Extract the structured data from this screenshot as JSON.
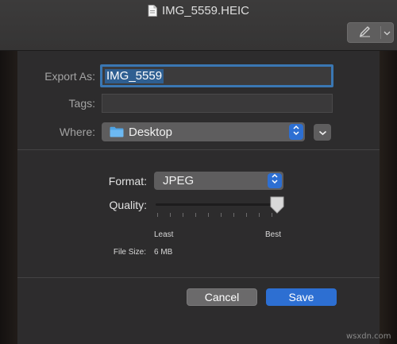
{
  "window": {
    "title": "IMG_5559.HEIC",
    "title_icon": "document-icon",
    "markup_icon": "markup-pen-icon"
  },
  "dialog": {
    "export_as_label": "Export As:",
    "export_as_value": "IMG_5559",
    "tags_label": "Tags:",
    "tags_value": "",
    "where_label": "Where:",
    "where_value": "Desktop",
    "where_icon": "folder-icon",
    "format_label": "Format:",
    "format_value": "JPEG",
    "quality_label": "Quality:",
    "quality_level": 1.0,
    "quality_min_label": "Least",
    "quality_max_label": "Best",
    "file_size_label": "File Size:",
    "file_size_value": "6 MB",
    "cancel_label": "Cancel",
    "save_label": "Save"
  },
  "colors": {
    "accent": "#2d6fd2",
    "focus_ring": "#3a77b3",
    "sheet_bg": "#2d2c2d"
  },
  "watermark": "wsxdn.com"
}
